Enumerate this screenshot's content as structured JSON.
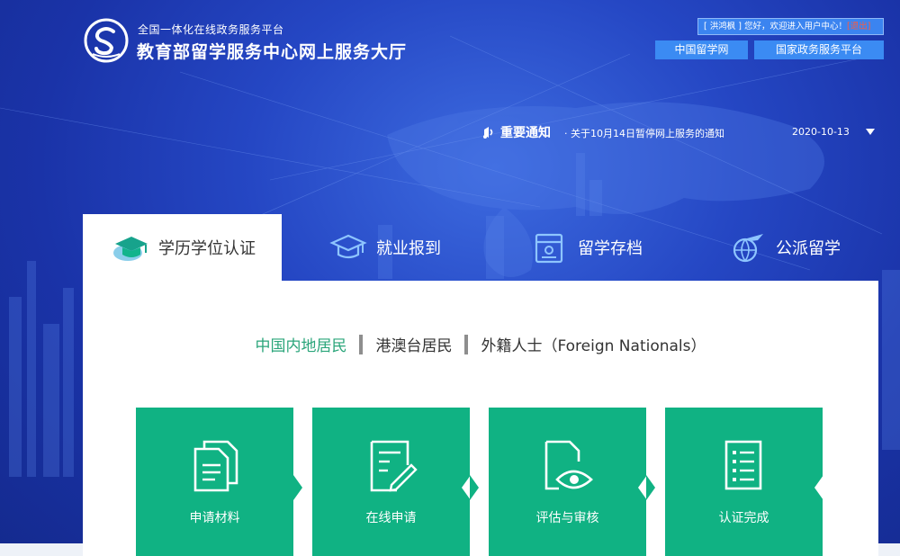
{
  "header": {
    "platform_subtitle": "全国一体化在线政务服务平台",
    "site_title": "教育部留学服务中心网上服务大厅",
    "user_greeting": "[ 洪鸿枫 ] 您好，欢迎进入用户中心！",
    "logout_label": "[退出]",
    "links": [
      "中国留学网",
      "国家政务服务平台"
    ]
  },
  "notice": {
    "label": "重要通知",
    "text": "· 关于10月14日暂停网上服务的通知",
    "date": "2020-10-13"
  },
  "tabs": [
    {
      "label": "学历学位认证",
      "icon": "graduation-cap-icon",
      "active": true
    },
    {
      "label": "就业报到",
      "icon": "mortarboard-icon",
      "active": false
    },
    {
      "label": "留学存档",
      "icon": "archive-folder-icon",
      "active": false
    },
    {
      "label": "公派留学",
      "icon": "globe-plane-icon",
      "active": false
    }
  ],
  "resident_tabs": [
    {
      "label": "中国内地居民",
      "active": true
    },
    {
      "label": "港澳台居民",
      "active": false
    },
    {
      "label": "外籍人士（Foreign Nationals）",
      "active": false
    }
  ],
  "steps": [
    {
      "label": "申请材料",
      "icon": "documents-icon"
    },
    {
      "label": "在线申请",
      "icon": "form-edit-icon"
    },
    {
      "label": "评估与审核",
      "icon": "document-eye-icon"
    },
    {
      "label": "认证完成",
      "icon": "checklist-icon"
    }
  ],
  "colors": {
    "accent_green": "#10b283",
    "active_text_green": "#2aa57a",
    "link_blue": "#3b8bf3",
    "logout_red": "#ff5a3c"
  }
}
